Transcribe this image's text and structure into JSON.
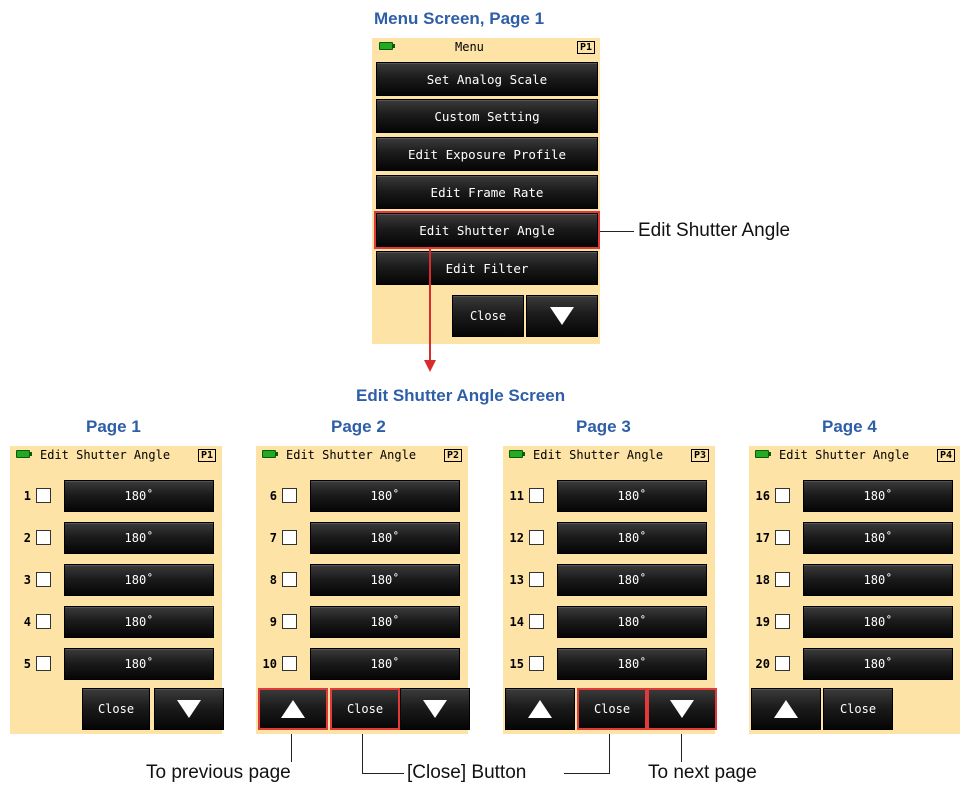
{
  "captions": {
    "menu_screen": "Menu Screen, Page 1",
    "edit_screen": "Edit Shutter Angle Screen",
    "pages": [
      "Page 1",
      "Page 2",
      "Page 3",
      "Page 4"
    ]
  },
  "menu": {
    "title": "Menu",
    "page_tag": "P1",
    "items": [
      "Set Analog Scale",
      "Custom Setting",
      "Edit Exposure Profile",
      "Edit Frame Rate",
      "Edit Shutter Angle",
      "Edit Filter"
    ],
    "close_label": "Close"
  },
  "edit_screens": [
    {
      "title": "Edit Shutter Angle",
      "page_tag": "P1",
      "rows": [
        {
          "num": "1",
          "value": "180˚"
        },
        {
          "num": "2",
          "value": "180˚"
        },
        {
          "num": "3",
          "value": "180˚"
        },
        {
          "num": "4",
          "value": "180˚"
        },
        {
          "num": "5",
          "value": "180˚"
        }
      ],
      "close_label": "Close"
    },
    {
      "title": "Edit Shutter Angle",
      "page_tag": "P2",
      "rows": [
        {
          "num": "6",
          "value": "180˚"
        },
        {
          "num": "7",
          "value": "180˚"
        },
        {
          "num": "8",
          "value": "180˚"
        },
        {
          "num": "9",
          "value": "180˚"
        },
        {
          "num": "10",
          "value": "180˚"
        }
      ],
      "close_label": "Close"
    },
    {
      "title": "Edit Shutter Angle",
      "page_tag": "P3",
      "rows": [
        {
          "num": "11",
          "value": "180˚"
        },
        {
          "num": "12",
          "value": "180˚"
        },
        {
          "num": "13",
          "value": "180˚"
        },
        {
          "num": "14",
          "value": "180˚"
        },
        {
          "num": "15",
          "value": "180˚"
        }
      ],
      "close_label": "Close"
    },
    {
      "title": "Edit Shutter Angle",
      "page_tag": "P4",
      "rows": [
        {
          "num": "16",
          "value": "180˚"
        },
        {
          "num": "17",
          "value": "180˚"
        },
        {
          "num": "18",
          "value": "180˚"
        },
        {
          "num": "19",
          "value": "180˚"
        },
        {
          "num": "20",
          "value": "180˚"
        }
      ],
      "close_label": "Close"
    }
  ],
  "callouts": {
    "edit_shutter_angle": "Edit Shutter Angle",
    "previous_page": "To previous page",
    "close_button": "[Close] Button",
    "next_page": "To next page"
  },
  "colors": {
    "screen_bg": "#fde3a6",
    "caption": "#2f5ea8",
    "highlight": "#e23a3a",
    "battery": "#22aa22"
  }
}
